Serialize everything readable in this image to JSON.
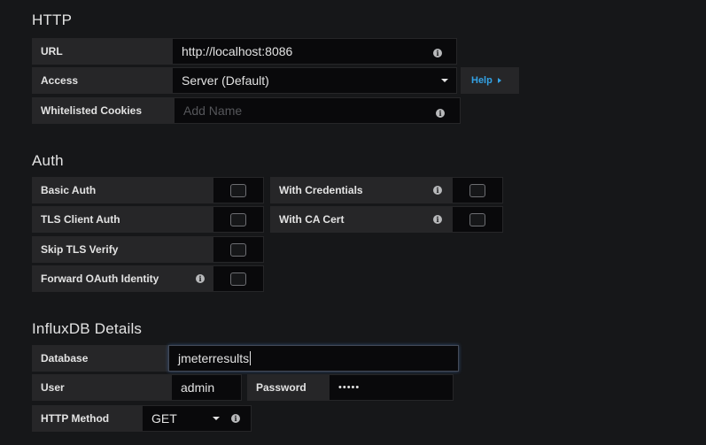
{
  "http": {
    "title": "HTTP",
    "url": {
      "label": "URL",
      "value": "http://localhost:8086"
    },
    "access": {
      "label": "Access",
      "value": "Server (Default)",
      "help_label": "Help"
    },
    "cookies": {
      "label": "Whitelisted Cookies",
      "placeholder": "Add Name"
    }
  },
  "auth": {
    "title": "Auth",
    "basic_auth": {
      "label": "Basic Auth",
      "checked": false
    },
    "with_credentials": {
      "label": "With Credentials",
      "checked": false
    },
    "tls_client_auth": {
      "label": "TLS Client Auth",
      "checked": false
    },
    "with_ca_cert": {
      "label": "With CA Cert",
      "checked": false
    },
    "skip_tls_verify": {
      "label": "Skip TLS Verify",
      "checked": false
    },
    "forward_oauth": {
      "label": "Forward OAuth Identity",
      "checked": false
    }
  },
  "influx": {
    "title": "InfluxDB Details",
    "database": {
      "label": "Database",
      "value": "jmeterresults"
    },
    "user": {
      "label": "User",
      "value": "admin"
    },
    "password": {
      "label": "Password",
      "value": "•••••"
    },
    "http_method": {
      "label": "HTTP Method",
      "value": "GET"
    }
  },
  "icons": {
    "info": "info-icon",
    "dropdown": "caret-down-icon",
    "help_arrow": "caret-right-icon"
  },
  "colors": {
    "background": "#161719",
    "label_bg": "#262628",
    "input_bg": "#09090b",
    "accent_link": "#33a2e5",
    "text": "#e3e3e3"
  }
}
